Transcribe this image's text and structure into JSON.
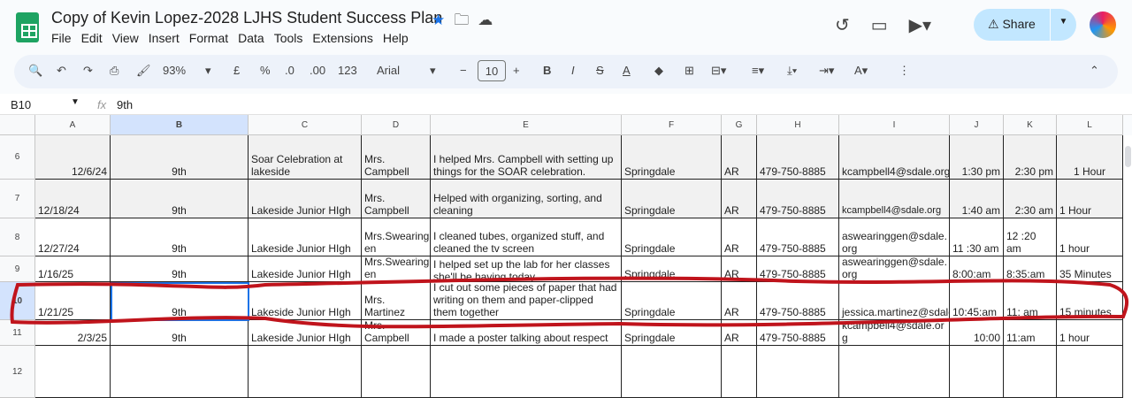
{
  "doc": {
    "title": "Copy of  Kevin Lopez-2028 LJHS Student Success Plan",
    "menu": [
      "File",
      "Edit",
      "View",
      "Insert",
      "Format",
      "Data",
      "Tools",
      "Extensions",
      "Help"
    ],
    "share": "Share"
  },
  "toolbar": {
    "zoom": "93%",
    "currency": "£",
    "percent": "%",
    "dec_dec": ".0",
    "dec_inc": ".00",
    "number": "123",
    "font": "Arial",
    "font_size": "10"
  },
  "formula": {
    "cell_ref": "B10",
    "fx": "fx",
    "value": "9th"
  },
  "columns": [
    "A",
    "B",
    "C",
    "D",
    "E",
    "F",
    "G",
    "H",
    "I",
    "J",
    "K",
    "L"
  ],
  "rows": [
    {
      "num": "6",
      "cells": [
        "12/6/24",
        "9th",
        "Soar Celebration at lakeside",
        "Mrs. Campbell",
        "I helped Mrs. Campbell with setting up things for the SOAR celebration.",
        "Springdale",
        "AR",
        "479-750-8885",
        "kcampbell4@sdale.org",
        "1:30 pm",
        "2:30 pm",
        "1 Hour"
      ]
    },
    {
      "num": "7",
      "cells": [
        "12/18/24",
        "9th",
        "Lakeside Junior HIgh",
        "Mrs. Campbell",
        "Helped with organizing, sorting, and cleaning",
        "Springdale",
        "AR",
        "479-750-8885",
        "kcampbell4@sdale.org",
        "1:40 am",
        "2:30 am",
        "1 Hour"
      ]
    },
    {
      "num": "8",
      "cells": [
        "12/27/24",
        "9th",
        "Lakeside Junior HIgh",
        "Mrs.Swearing en",
        "I cleaned tubes, organized stuff, and cleaned the tv screen",
        "Springdale",
        "AR",
        "479-750-8885",
        "aswearinggen@sdale. org",
        "11 :30 am",
        "12 :20 am",
        "1 hour"
      ]
    },
    {
      "num": "9",
      "cells": [
        "1/16/25",
        "9th",
        "Lakeside Junior HIgh",
        "Mrs.Swearing en",
        "I helped set up the lab for her classes she'll be having today",
        "Springdale",
        "AR",
        "479-750-8885",
        "aswearinggen@sdale. org",
        "8:00:am",
        "8:35:am",
        "35 Minutes"
      ]
    },
    {
      "num": "10",
      "cells": [
        "1/21/25",
        "9th",
        "Lakeside Junior HIgh",
        "Mrs. Martinez",
        "I cut out some pieces of paper that had writing on them and paper-clipped them together",
        "Springdale",
        "AR",
        "479-750-8885",
        "jessica.martinez@sdale.org",
        "10:45:am",
        "11: am",
        "15 minutes"
      ]
    },
    {
      "num": "11",
      "cells": [
        "2/3/25",
        "9th",
        "Lakeside Junior HIgh",
        "Mrs. Campbell",
        "I made a poster talking about respect",
        "Springdale",
        "AR",
        "479-750-8885",
        "kcampbell4@sdale.or g",
        "10:00",
        "11:am",
        "1 hour"
      ]
    },
    {
      "num": "12",
      "cells": [
        "",
        "",
        "",
        "",
        "",
        "",
        "",
        "",
        "",
        "",
        "",
        ""
      ]
    }
  ],
  "annotation_color": "#c0141c"
}
